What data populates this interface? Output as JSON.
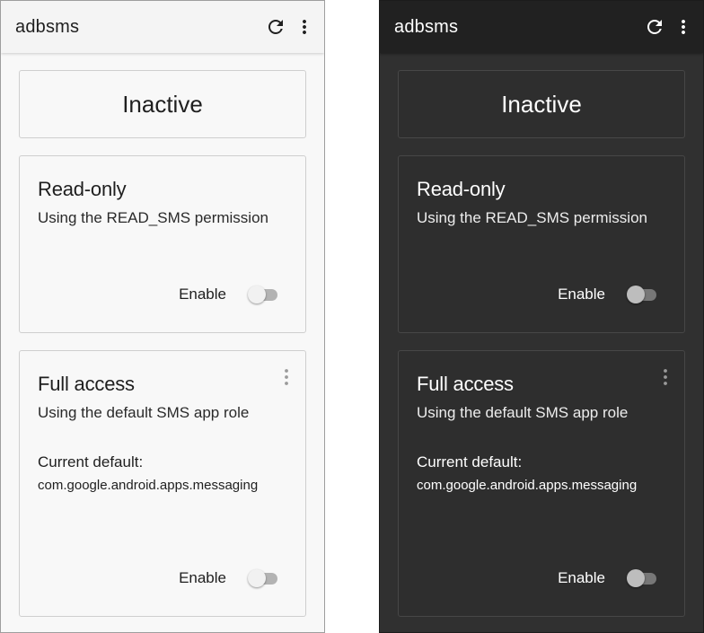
{
  "colors": {
    "light_background": "#f8f8f8",
    "dark_background": "#303030",
    "light_appbar": "#f4f4f4",
    "dark_appbar": "#212121",
    "switch_off_track_light": "#b3b3b3",
    "switch_off_track_dark": "#777777"
  },
  "screens": [
    {
      "theme": "light",
      "app_title": "adbsms",
      "actions": {
        "refresh_icon": "refresh-icon",
        "overflow_icon": "more-vert-icon"
      },
      "status": "Inactive",
      "read_only": {
        "title": "Read-only",
        "subtitle": "Using the READ_SMS permission",
        "enable_label": "Enable",
        "enabled": false
      },
      "full_access": {
        "title": "Full access",
        "subtitle": "Using the default SMS app role",
        "current_default_label": "Current default:",
        "current_default_value": "com.google.android.apps.messaging",
        "enable_label": "Enable",
        "enabled": false,
        "menu_icon": "more-vert-icon"
      }
    },
    {
      "theme": "dark",
      "app_title": "adbsms",
      "actions": {
        "refresh_icon": "refresh-icon",
        "overflow_icon": "more-vert-icon"
      },
      "status": "Inactive",
      "read_only": {
        "title": "Read-only",
        "subtitle": "Using the READ_SMS permission",
        "enable_label": "Enable",
        "enabled": false
      },
      "full_access": {
        "title": "Full access",
        "subtitle": "Using the default SMS app role",
        "current_default_label": "Current default:",
        "current_default_value": "com.google.android.apps.messaging",
        "enable_label": "Enable",
        "enabled": false,
        "menu_icon": "more-vert-icon"
      }
    }
  ]
}
